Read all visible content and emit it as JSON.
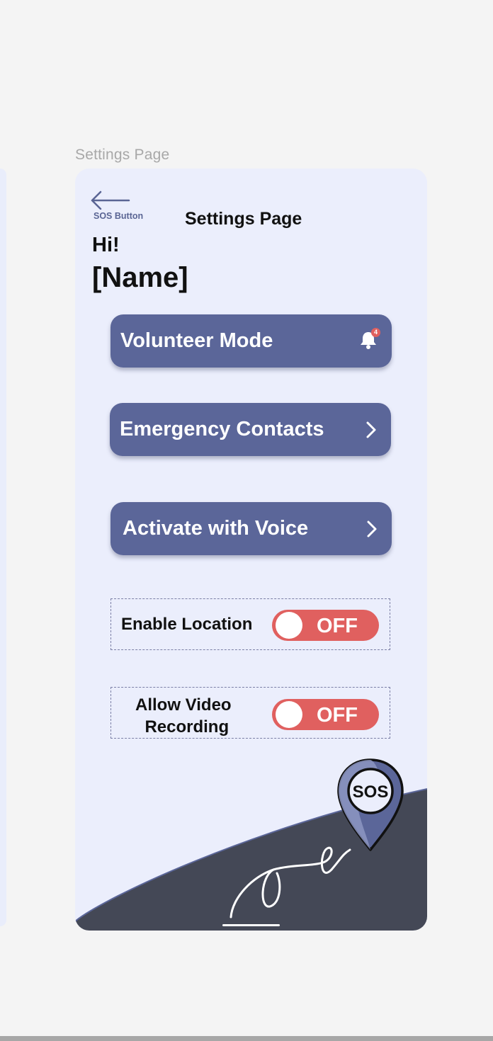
{
  "frame_label": "Settings Page",
  "header": {
    "back_label": "SOS Button",
    "title": "Settings Page"
  },
  "greeting": {
    "hi": "Hi!",
    "name": "[Name]"
  },
  "menu": {
    "volunteer": {
      "label": "Volunteer Mode",
      "badge": "4",
      "icon": "bell-icon"
    },
    "emergency": {
      "label": "Emergency Contacts",
      "icon": "chevron-right-icon"
    },
    "voice": {
      "label": "Activate with Voice",
      "icon": "chevron-right-icon"
    }
  },
  "toggles": {
    "location": {
      "label": "Enable Location",
      "state": "OFF"
    },
    "video": {
      "label_line1": "Allow Video",
      "label_line2": "Recording",
      "state": "OFF"
    }
  },
  "sos_pin": {
    "label": "SOS"
  },
  "colors": {
    "page_bg": "#f4f4f4",
    "phone_bg": "#ebeefc",
    "button": "#5b6699",
    "toggle_off": "#e0605f",
    "footer_wave": "#444856",
    "accent_text": "#5a6594"
  }
}
